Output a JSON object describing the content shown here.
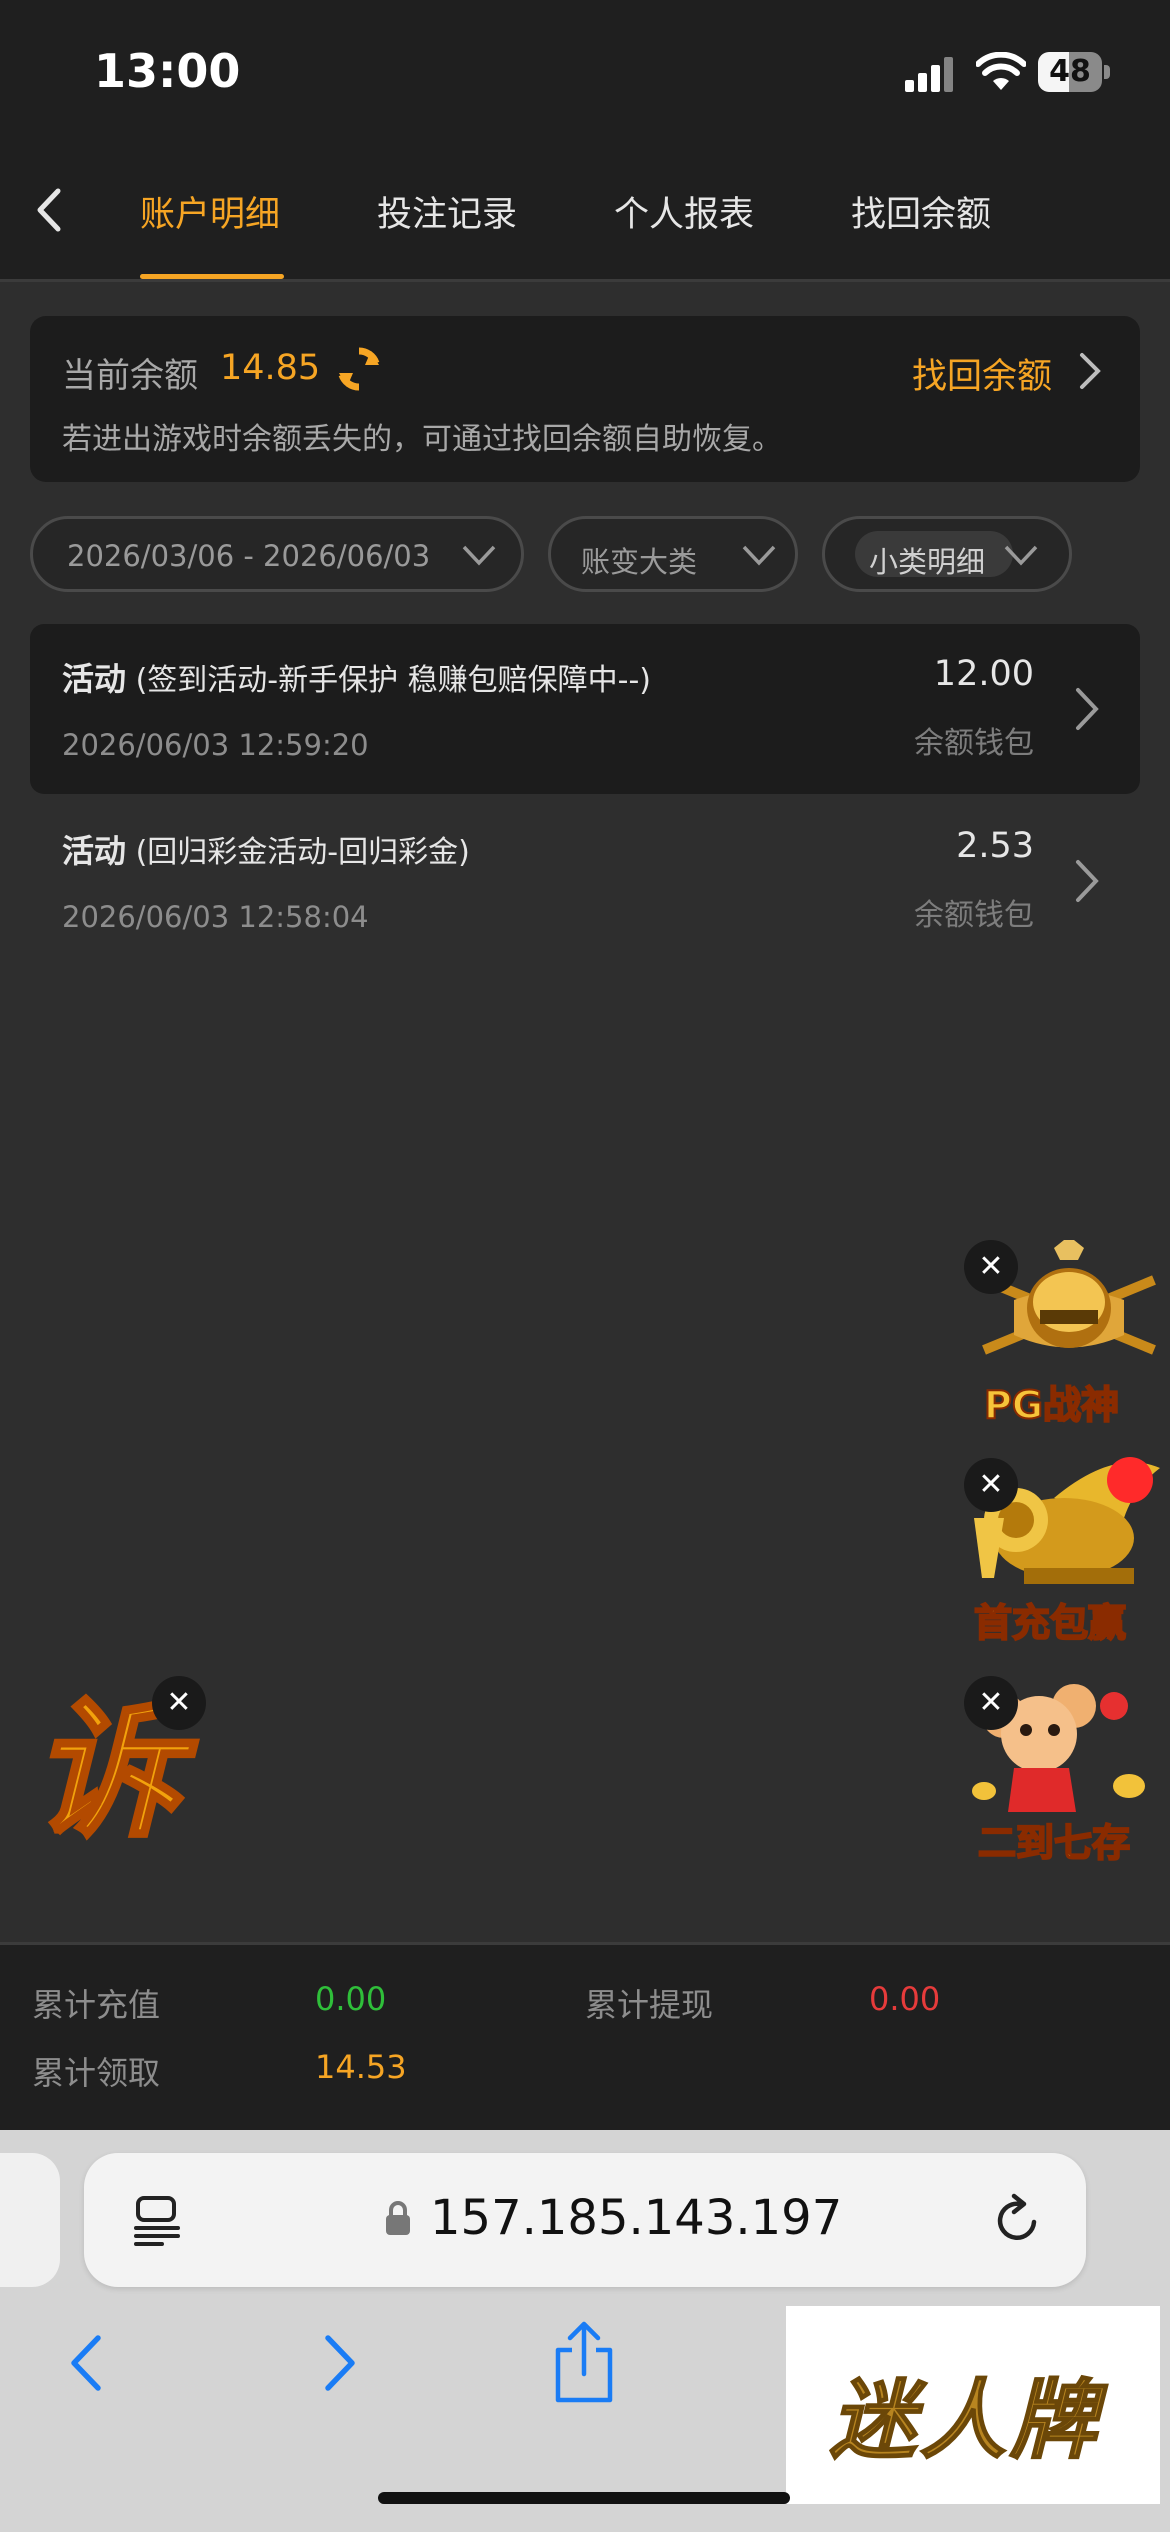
{
  "status_bar": {
    "time": "13:00",
    "battery": "48",
    "battery_level": 0.48
  },
  "tabs": [
    {
      "label": "账户明细",
      "active": true
    },
    {
      "label": "投注记录",
      "active": false
    },
    {
      "label": "个人报表",
      "active": false
    },
    {
      "label": "找回余额",
      "active": false
    }
  ],
  "balance": {
    "label": "当前余额",
    "value": "14.85",
    "recover_label": "找回余额",
    "hint": "若进出游戏时余额丢失的，可通过找回余额自助恢复。"
  },
  "filters": {
    "date_range": "2026/03/06 - 2026/06/03",
    "category": "账变大类",
    "subcategory": "小类明细"
  },
  "records": [
    {
      "type": "活动",
      "detail": "(签到活动-新手保护 稳赚包赔保障中--)",
      "time": "2026/06/03 12:59:20",
      "amount": "12.00",
      "wallet": "余额钱包"
    },
    {
      "type": "活动",
      "detail": "(回归彩金活动-回归彩金)",
      "time": "2026/06/03 12:58:04",
      "amount": "2.53",
      "wallet": "余额钱包"
    }
  ],
  "badges": {
    "pg": "PG战神",
    "first_charge": "首充包赢",
    "deposit": "二到七存",
    "left_glyph": "诉"
  },
  "totals": {
    "recharge_label": "累计充值",
    "recharge_value": "0.00",
    "withdraw_label": "累计提现",
    "withdraw_value": "0.00",
    "claimed_label": "累计领取",
    "claimed_value": "14.53"
  },
  "browser": {
    "url": "157.185.143.197"
  },
  "watermark": "迷人牌",
  "colors": {
    "accent": "#f6a524",
    "green": "#2fbf3a",
    "red": "#e63b3b"
  }
}
